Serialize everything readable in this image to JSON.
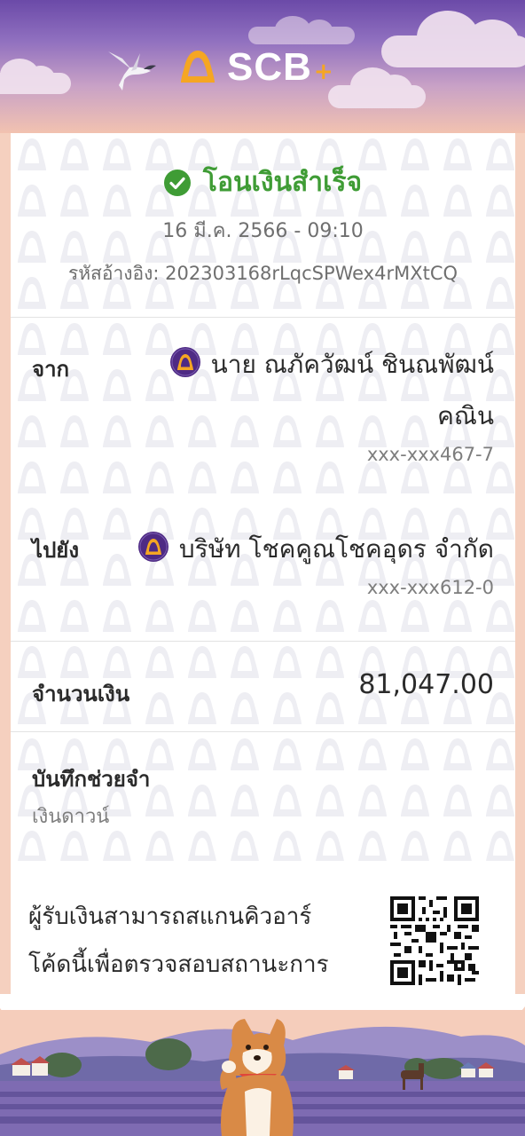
{
  "brand": {
    "name": "SCB",
    "plus": "+"
  },
  "status": {
    "text": "โอนเงินสำเร็จ"
  },
  "datetime": "16 มี.ค. 2566 - 09:10",
  "reference": {
    "label": "รหัสอ้างอิง:",
    "value": "202303168rLqcSPWex4rMXtCQ",
    "full": "รหัสอ้างอิง: 202303168rLqcSPWex4rMXtCQ"
  },
  "from": {
    "label": "จาก",
    "name_line1": "นาย ณภัควัฒน์ ชินณพัฒน์",
    "name_line2": "คณิน",
    "account": "xxx-xxx467-7"
  },
  "to": {
    "label": "ไปยัง",
    "name": "บริษัท โชคคูณโชคอุดร จำกัด",
    "account": "xxx-xxx612-0"
  },
  "amount": {
    "label": "จำนวนเงิน",
    "value": "81,047.00"
  },
  "memo": {
    "label": "บันทึกช่วยจำ",
    "value": "เงินดาวน์"
  },
  "qr": {
    "text_line1": "ผู้รับเงินสามารถสแกนคิวอาร์",
    "text_line2": "โค้ดนี้เพื่อตรวจสอบสถานะการ"
  },
  "colors": {
    "brand_purple": "#4e2a84",
    "brand_gold": "#f5a623",
    "success_green": "#3f9c35"
  }
}
